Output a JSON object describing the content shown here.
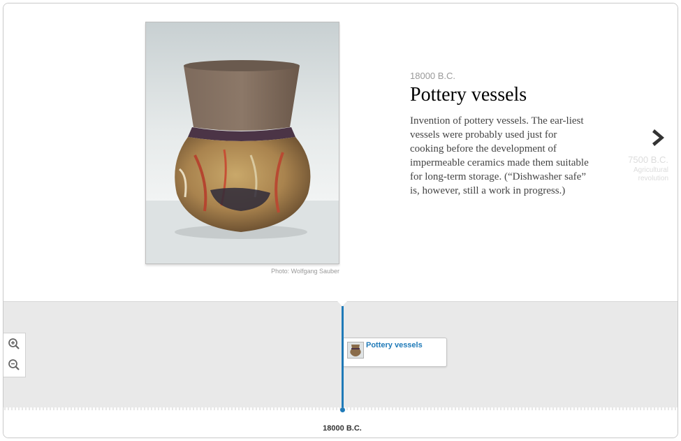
{
  "slide": {
    "date": "18000 B.C.",
    "headline": "Pottery vessels",
    "body": "Invention of pottery vessels. The ear-liest vessels were probably used just for cooking before the development of impermeable ceramics made them suitable for long-term storage. (“Dishwasher safe” is, however, still a work in progress.)",
    "credit": "Photo: Wolfgang Sauber"
  },
  "next": {
    "icon": "chevron-right-icon",
    "date": "7500 B.C.",
    "title": "Agricultural revolution"
  },
  "zoom": {
    "in_icon": "zoom-in-icon",
    "out_icon": "zoom-out-icon"
  },
  "timeline": {
    "event_title": "Pottery vessels",
    "axis_label": "18000 B.C."
  },
  "colors": {
    "accent": "#1f7ab8",
    "nav_background": "#e9e9e9",
    "muted_text": "#999999"
  }
}
